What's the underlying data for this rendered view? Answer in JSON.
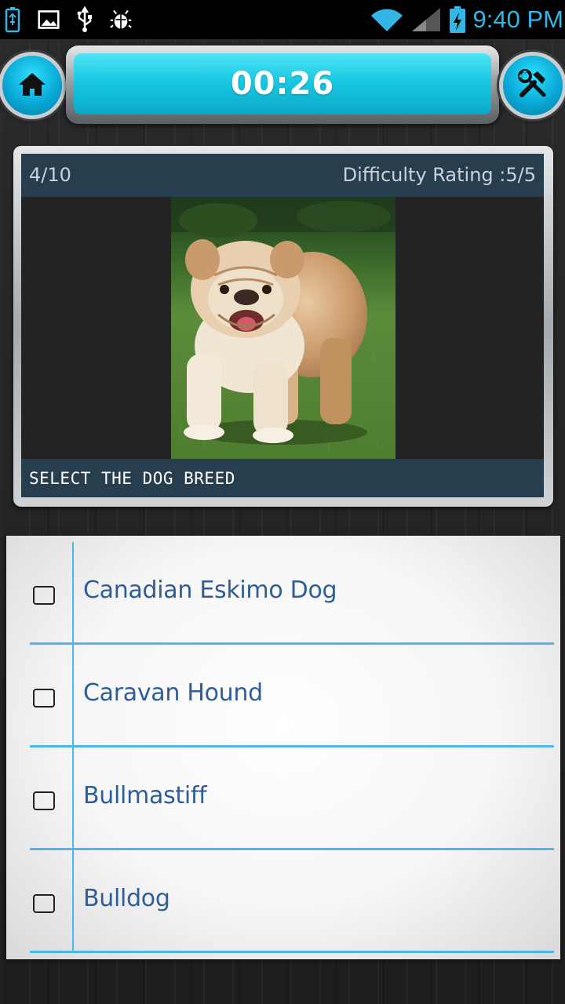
{
  "status_bar": {
    "time": "9:40 PM",
    "left_icons": [
      "usb-battery-icon",
      "image-icon",
      "usb-icon",
      "debug-icon"
    ],
    "right_icons": [
      "wifi-icon",
      "signal-icon",
      "battery-charging-icon"
    ]
  },
  "top_bar": {
    "timer": "00:26",
    "home_icon": "home-icon",
    "tools_icon": "tools-icon",
    "accent": "#19c8e2"
  },
  "question": {
    "progress": "4/10",
    "difficulty": "Difficulty Rating :5/5",
    "prompt": "SELECT THE DOG BREED",
    "image": "bulldog-photo"
  },
  "answers": [
    {
      "label": "Canadian Eskimo Dog",
      "checked": false
    },
    {
      "label": "Caravan Hound",
      "checked": false
    },
    {
      "label": "Bullmastiff",
      "checked": false
    },
    {
      "label": "Bulldog",
      "checked": false
    }
  ],
  "colors": {
    "status_accent": "#33b5e5",
    "header_bg": "#263e4e",
    "answer_text": "#2f5d95",
    "rule_line": "#4db6ee"
  }
}
